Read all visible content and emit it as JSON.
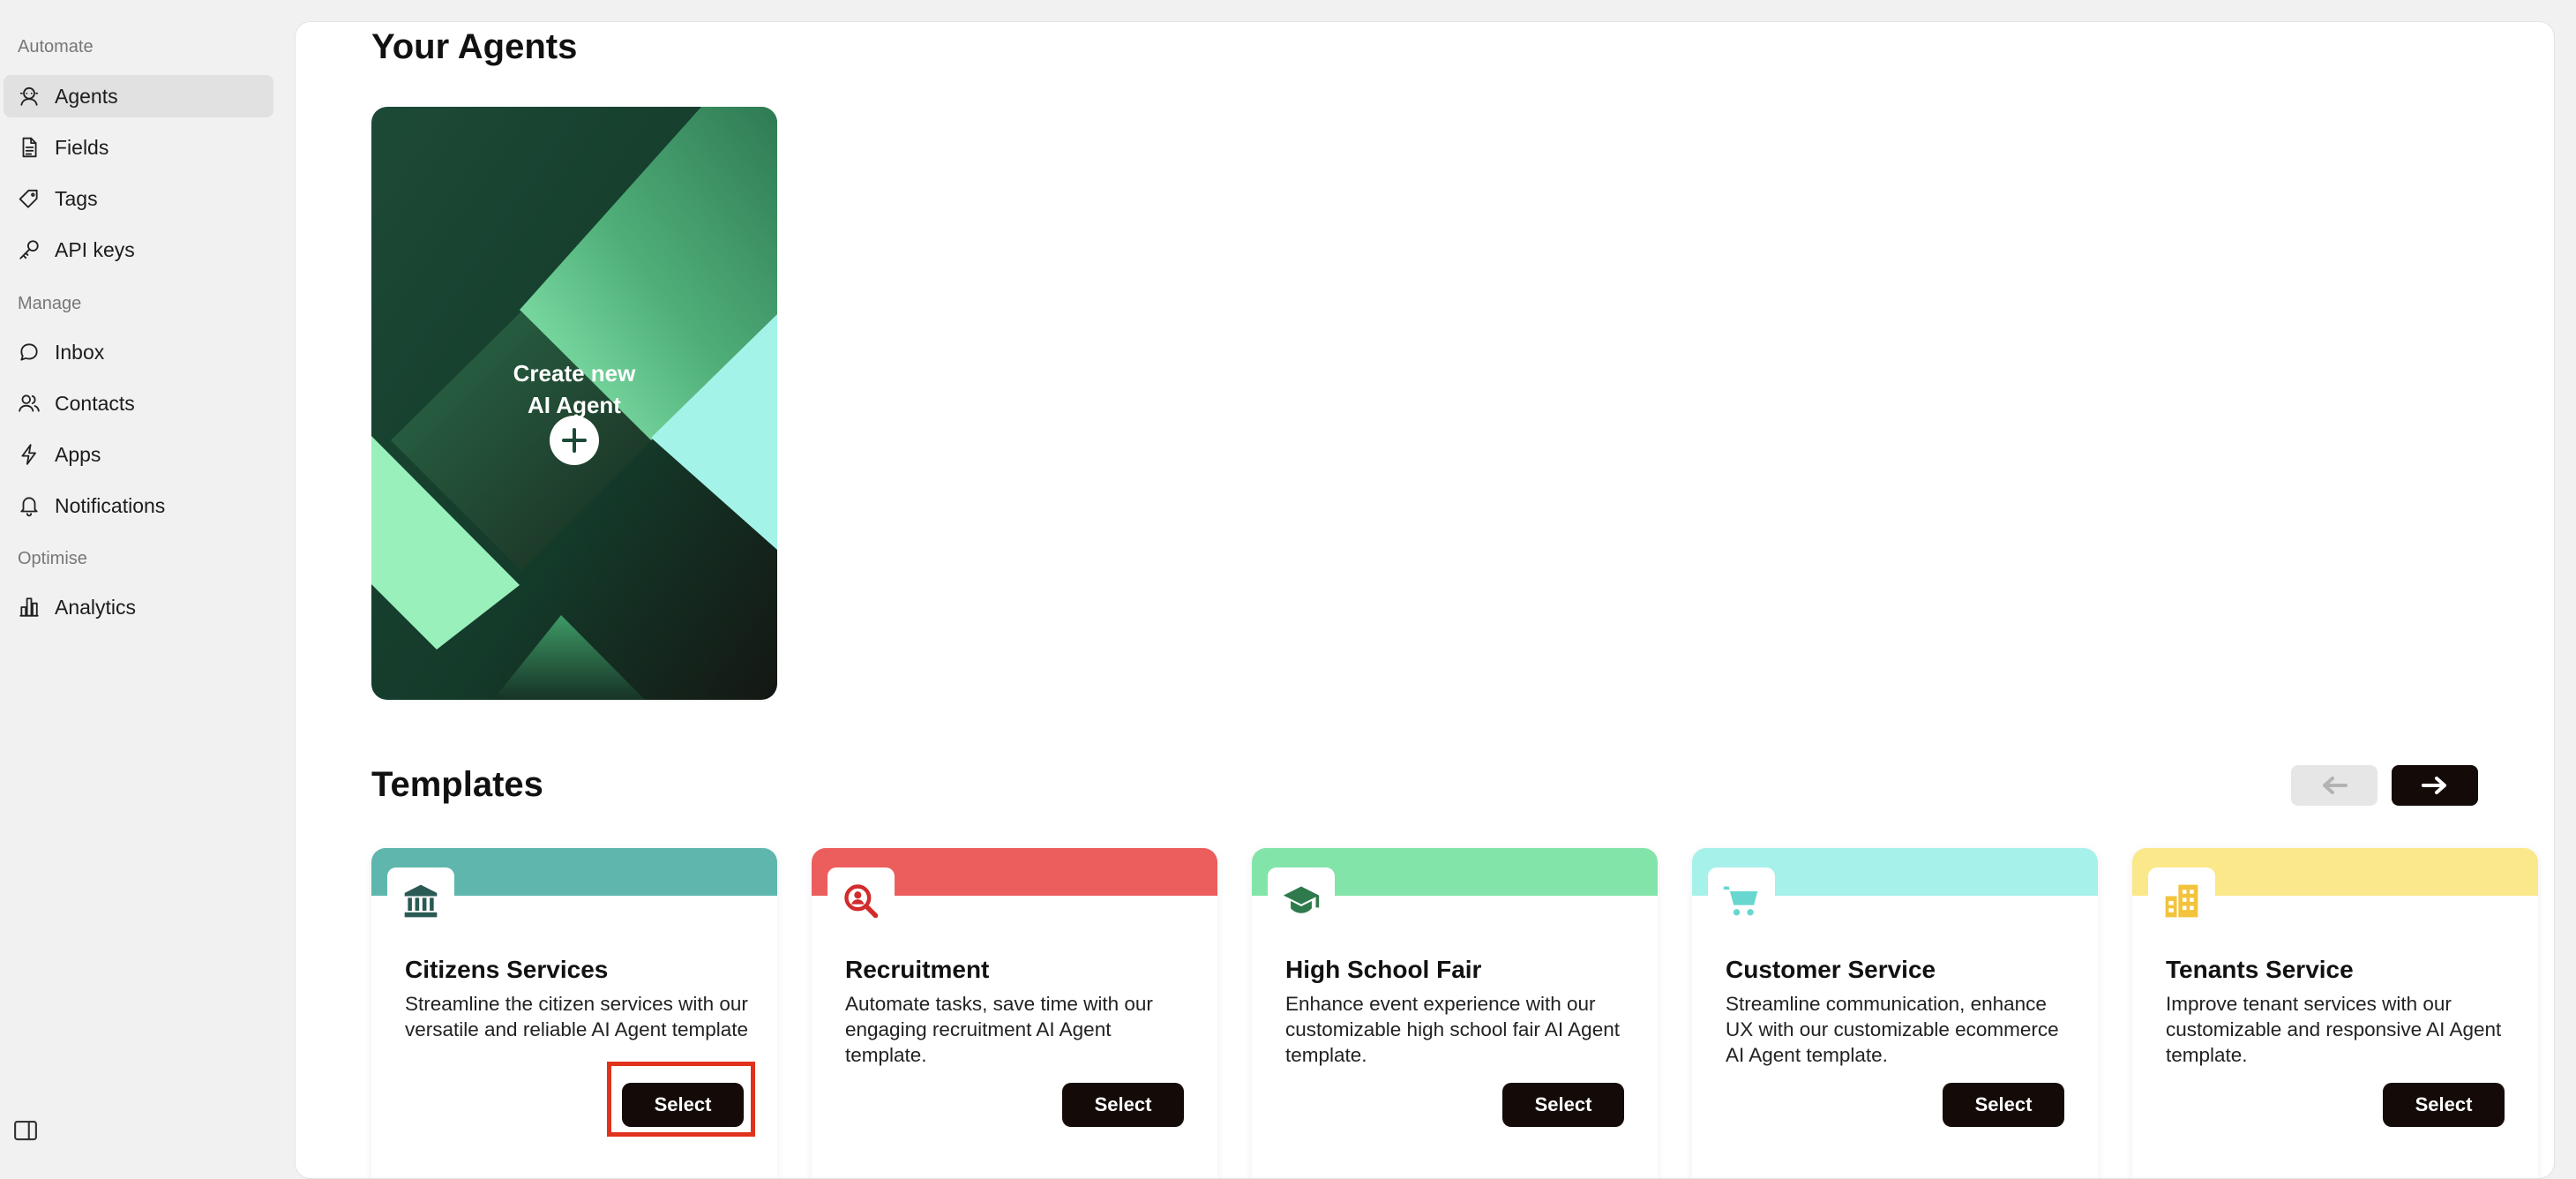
{
  "sidebar": {
    "sections": [
      {
        "label": "Automate",
        "items": [
          {
            "label": "Agents",
            "icon": "robot-icon",
            "active": true
          },
          {
            "label": "Fields",
            "icon": "document-icon"
          },
          {
            "label": "Tags",
            "icon": "tag-icon"
          },
          {
            "label": "API keys",
            "icon": "key-icon"
          }
        ]
      },
      {
        "label": "Manage",
        "items": [
          {
            "label": "Inbox",
            "icon": "chat-bubble-icon"
          },
          {
            "label": "Contacts",
            "icon": "users-icon"
          },
          {
            "label": "Apps",
            "icon": "lightning-icon"
          },
          {
            "label": "Notifications",
            "icon": "bell-icon"
          }
        ]
      },
      {
        "label": "Optimise",
        "items": [
          {
            "label": "Analytics",
            "icon": "bar-chart-icon"
          }
        ]
      }
    ],
    "toggle_icon": "sidebar-toggle-icon"
  },
  "main": {
    "agents_title": "Your Agents",
    "create_card": {
      "line1": "Create new",
      "line2": "AI Agent"
    },
    "templates_title": "Templates",
    "templates": [
      {
        "title": "Citizens Services",
        "description": "Streamline the citizen services with our versatile and reliable AI Agent template",
        "button": "Select",
        "color": "#5fb6ad",
        "icon": "bank-icon",
        "icon_color": "#2b5a54"
      },
      {
        "title": "Recruitment",
        "description": "Automate tasks, save time with our engaging recruitment AI Agent template.",
        "button": "Select",
        "color": "#ec5e5e",
        "icon": "magnifier-person-icon",
        "icon_color": "#d22b2b"
      },
      {
        "title": "High School Fair",
        "description": "Enhance event experience with our customizable high school fair AI Agent template.",
        "button": "Select",
        "color": "#83e4aa",
        "icon": "graduation-cap-icon",
        "icon_color": "#2f7a4c"
      },
      {
        "title": "Customer Service",
        "description": "Streamline communication, enhance UX with our customizable ecommerce AI Agent template.",
        "button": "Select",
        "color": "#a6f1ea",
        "icon": "shopping-cart-icon",
        "icon_color": "#67d7cf"
      },
      {
        "title": "Tenants Service",
        "description": "Improve tenant services with our customizable and responsive AI Agent template.",
        "button": "Select",
        "color": "#fae88a",
        "icon": "buildings-icon",
        "icon_color": "#f2c33b"
      }
    ]
  }
}
